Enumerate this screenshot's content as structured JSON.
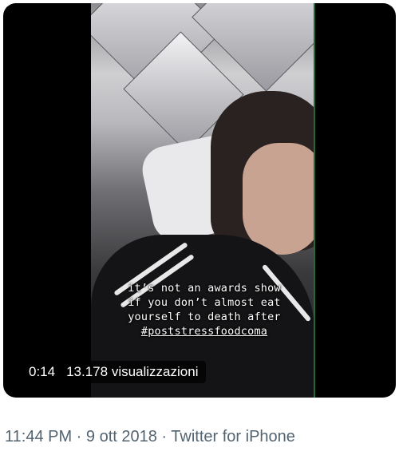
{
  "media": {
    "caption_lines": [
      "it’s not an awards show",
      "if you don’t almost eat",
      "yourself to death after"
    ],
    "caption_hashtag": "#poststressfoodcoma",
    "timestamp": "0:14",
    "views": "13.178 visualizzazioni"
  },
  "tweet_meta": {
    "time": "11:44 PM",
    "separator1": " · ",
    "date": "9 ott 2018",
    "separator2": " · ",
    "source": "Twitter for iPhone"
  }
}
